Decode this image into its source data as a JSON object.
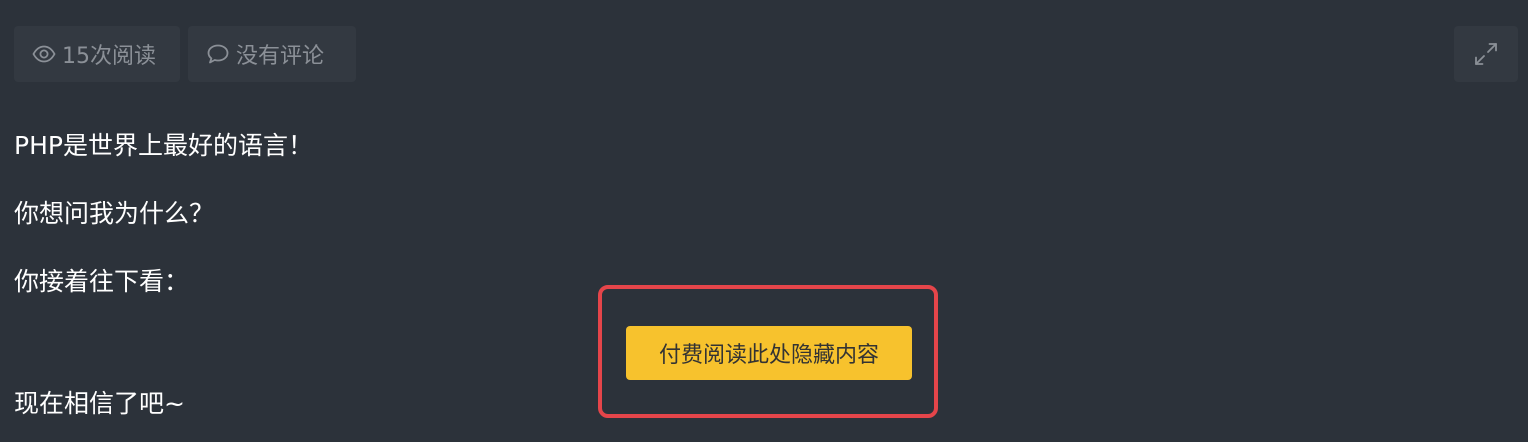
{
  "meta": {
    "views_label": "15次阅读",
    "comments_label": "没有评论"
  },
  "article": {
    "paragraphs": [
      "PHP是世界上最好的语言！",
      "你想问我为什么？",
      "你接着往下看：",
      "现在相信了吧~"
    ],
    "paid_button_label": "付费阅读此处隐藏内容"
  },
  "colors": {
    "background": "#2c323a",
    "meta_button_bg": "#333941",
    "muted_text": "#8b9097",
    "pay_button": "#f7c22d",
    "highlight_border": "#e5454a"
  },
  "icons": {
    "views": "eye-icon",
    "comments": "comment-bubble-icon",
    "expand": "expand-arrows-icon"
  }
}
